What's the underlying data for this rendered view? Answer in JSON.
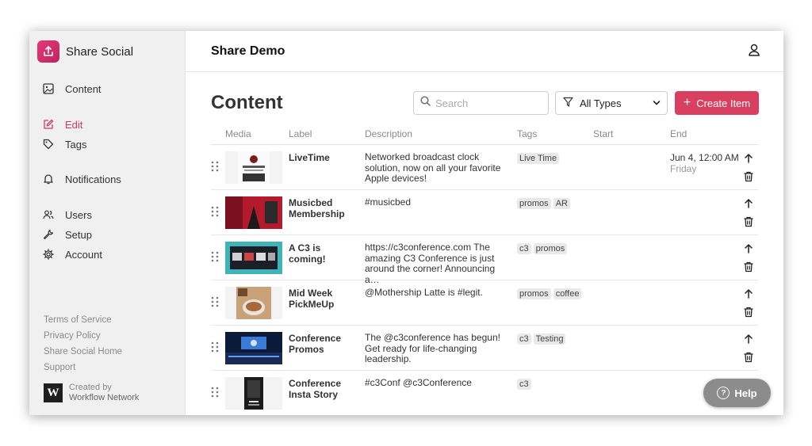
{
  "brand": {
    "name": "Share Social",
    "icon": "share-upload-icon",
    "color": "#d9346f"
  },
  "sidebar": {
    "items": [
      {
        "label": "Content",
        "icon": "image-icon"
      },
      {
        "label": "Edit",
        "icon": "edit-icon",
        "active": true
      },
      {
        "label": "Tags",
        "icon": "tag-icon"
      },
      {
        "label": "Notifications",
        "icon": "bell-icon"
      },
      {
        "label": "Users",
        "icon": "users-icon"
      },
      {
        "label": "Setup",
        "icon": "wrench-icon"
      },
      {
        "label": "Account",
        "icon": "gear-icon"
      }
    ],
    "footer_links": [
      "Terms of Service",
      "Privacy Policy",
      "Share Social Home",
      "Support"
    ],
    "creator": {
      "logo": "W",
      "line1": "Created by",
      "line2": "Workflow Network"
    }
  },
  "header": {
    "title": "Share Demo",
    "user_icon": "user-icon"
  },
  "content": {
    "title": "Content",
    "search_placeholder": "Search",
    "filter_label": "All Types",
    "create_label": "Create Item",
    "accent": "#d9405f"
  },
  "table": {
    "columns": [
      "Media",
      "Label",
      "Description",
      "Tags",
      "Start",
      "End"
    ],
    "rows": [
      {
        "label": "LiveTime",
        "description": "Networked broadcast clock solution, now on all your favorite Apple devices!",
        "tags": [
          "Live Time"
        ],
        "start": "",
        "end": "Jun 4, 12:00 AM",
        "end_day": "Friday"
      },
      {
        "label": "Musicbed Membership",
        "description": "#musicbed",
        "tags": [
          "promos",
          "AR"
        ],
        "start": "",
        "end": "",
        "end_day": ""
      },
      {
        "label": "A C3 is coming!",
        "description": "https://c3conference.com The amazing C3 Conference is just around the corner! Announcing a…",
        "tags": [
          "c3",
          "promos"
        ],
        "start": "",
        "end": "",
        "end_day": ""
      },
      {
        "label": "Mid Week PickMeUp",
        "description": "@Mothership Latte is #legit.",
        "tags": [
          "promos",
          "coffee"
        ],
        "start": "",
        "end": "",
        "end_day": ""
      },
      {
        "label": "Conference Promos",
        "description": "The @c3conference has begun! Get ready for life-changing leadership.",
        "tags": [
          "c3",
          "Testing"
        ],
        "start": "",
        "end": "",
        "end_day": ""
      },
      {
        "label": "Conference Insta Story",
        "description": "#c3Conf @c3Conference",
        "tags": [
          "c3"
        ],
        "start": "",
        "end": "",
        "end_day": ""
      }
    ]
  },
  "help": {
    "label": "Help"
  }
}
